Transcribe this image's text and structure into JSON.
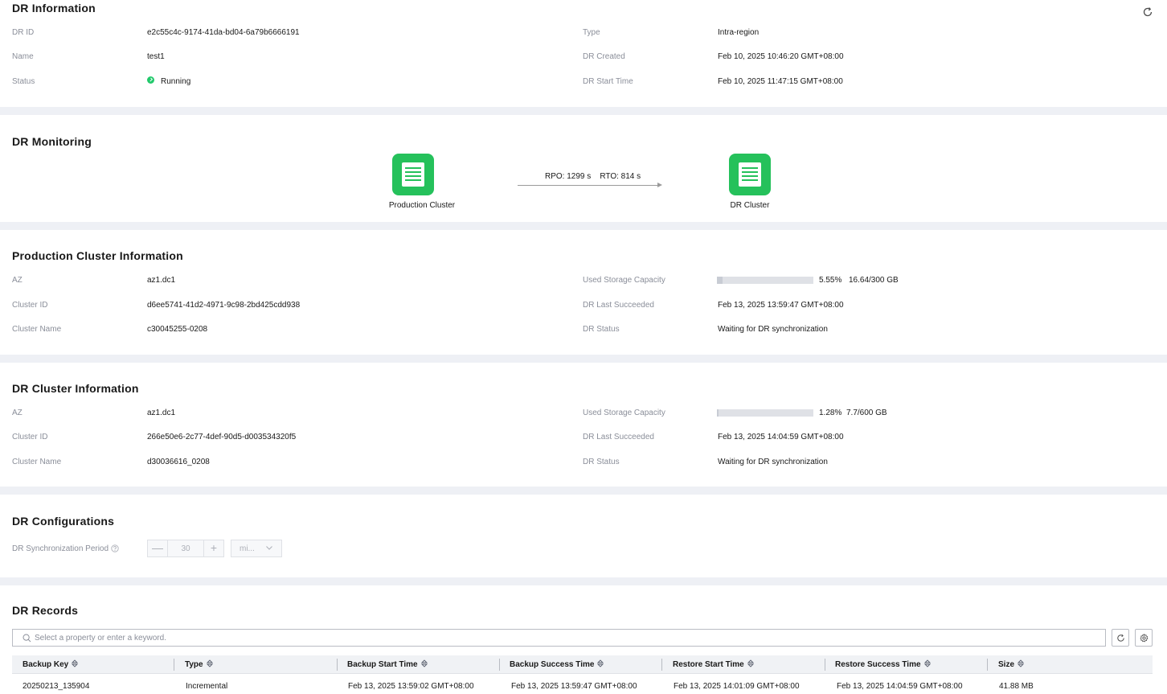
{
  "dr_info": {
    "title": "DR Information",
    "fields_left": [
      {
        "label": "DR ID",
        "value": "e2c55c4c-9174-41da-bd04-6a79b6666191"
      },
      {
        "label": "Name",
        "value": "test1"
      },
      {
        "label": "Status",
        "value": "Running"
      }
    ],
    "fields_right": [
      {
        "label": "Type",
        "value": "Intra-region"
      },
      {
        "label": "DR Created",
        "value": "Feb 10, 2025 10:46:20 GMT+08:00"
      },
      {
        "label": "DR Start Time",
        "value": "Feb 10, 2025 11:47:15 GMT+08:00"
      }
    ],
    "status_color": "#21c96b"
  },
  "dr_monitoring": {
    "title": "DR Monitoring",
    "production_label": "Production Cluster",
    "dr_label": "DR Cluster",
    "metrics": "RPO: 1299 s    RTO: 814 s",
    "icon_color": "#25c15b"
  },
  "production_cluster": {
    "title": "Production Cluster Information",
    "fields_left": [
      {
        "label": "AZ",
        "value": "az1.dc1"
      },
      {
        "label": "Cluster ID",
        "value": "d6ee5741-41d2-4971-9c98-2bd425cdd938"
      },
      {
        "label": "Cluster Name",
        "value": "c30045255-0208"
      }
    ],
    "storage": {
      "label": "Used Storage Capacity",
      "percent_text": "5.55%",
      "usage_text": "16.64/300 GB",
      "fraction": 0.0555
    },
    "fields_right": [
      {
        "label": "DR Last Succeeded",
        "value": "Feb 13, 2025 13:59:47 GMT+08:00"
      },
      {
        "label": "DR Status",
        "value": "Waiting for DR synchronization"
      }
    ]
  },
  "dr_cluster": {
    "title": "DR Cluster Information",
    "fields_left": [
      {
        "label": "AZ",
        "value": "az1.dc1"
      },
      {
        "label": "Cluster ID",
        "value": "266e50e6-2c77-4def-90d5-d003534320f5"
      },
      {
        "label": "Cluster Name",
        "value": "d30036616_0208"
      }
    ],
    "storage": {
      "label": "Used Storage Capacity",
      "percent_text": "1.28%",
      "usage_text": "7.7/600 GB",
      "fraction": 0.0128
    },
    "fields_right": [
      {
        "label": "DR Last Succeeded",
        "value": "Feb 13, 2025 14:04:59 GMT+08:00"
      },
      {
        "label": "DR Status",
        "value": "Waiting for DR synchronization"
      }
    ]
  },
  "dr_config": {
    "title": "DR Configurations",
    "sync_label": "DR Synchronization Period",
    "minus": "—",
    "plus": "+",
    "period_value": "30",
    "unit_value": "mi..."
  },
  "dr_records": {
    "title": "DR Records",
    "search_placeholder": "Select a property or enter a keyword.",
    "columns": [
      "Backup Key",
      "Type",
      "Backup Start Time",
      "Backup Success Time",
      "Restore Start Time",
      "Restore Success Time",
      "Size"
    ],
    "rows": [
      [
        "20250213_135904",
        "Incremental",
        "Feb 13, 2025 13:59:02 GMT+08:00",
        "Feb 13, 2025 13:59:47 GMT+08:00",
        "Feb 13, 2025 14:01:09 GMT+08:00",
        "Feb 13, 2025 14:04:59 GMT+08:00",
        "41.88 MB"
      ]
    ]
  }
}
